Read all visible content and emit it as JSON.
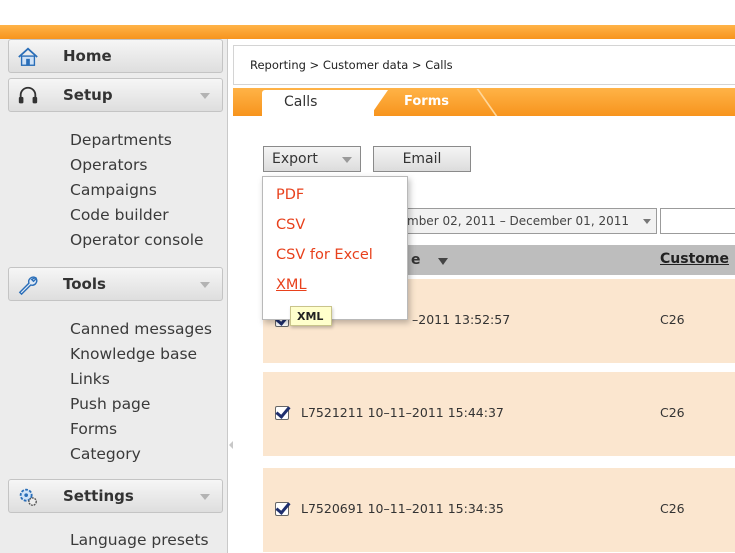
{
  "sidebar": {
    "sections": [
      {
        "label": "Home",
        "icon": "home-icon",
        "items": []
      },
      {
        "label": "Setup",
        "icon": "headset-icon",
        "items": [
          "Departments",
          "Operators",
          "Campaigns",
          "Code builder",
          "Operator console"
        ]
      },
      {
        "label": "Tools",
        "icon": "wrench-icon",
        "items": [
          "Canned messages",
          "Knowledge base",
          "Links",
          "Push page",
          "Forms",
          "Category"
        ]
      },
      {
        "label": "Settings",
        "icon": "gears-icon",
        "items": [
          "Language presets"
        ]
      }
    ]
  },
  "breadcrumb": "Reporting > Customer data > Calls",
  "tabs": [
    {
      "label": "Calls",
      "active": true
    },
    {
      "label": "Forms",
      "active": false
    }
  ],
  "toolbar": {
    "export_label": "Export",
    "email_label": "Email",
    "date_range": "mber 02, 2011 – December 01, 2011",
    "search_value": ""
  },
  "export_menu": {
    "items": [
      "PDF",
      "CSV",
      "CSV for Excel",
      "XML"
    ],
    "hovered": "XML",
    "tooltip": "XML"
  },
  "table": {
    "headers": {
      "date_partial": "e",
      "customer_partial": "Custome"
    },
    "rows": [
      {
        "checked": true,
        "text": "–2011 13:52:57",
        "customer": "C26"
      },
      {
        "checked": true,
        "text": "L7521211 10–11–2011 15:44:37",
        "customer": "C26"
      },
      {
        "checked": true,
        "text": "L7520691 10–11–2011 15:34:35",
        "customer": "C26"
      }
    ]
  },
  "colors": {
    "accent_orange": "#f7941d",
    "menu_text": "#e8411c",
    "row_bg": "#fbe6cf",
    "header_bg": "#bdbdbd"
  }
}
